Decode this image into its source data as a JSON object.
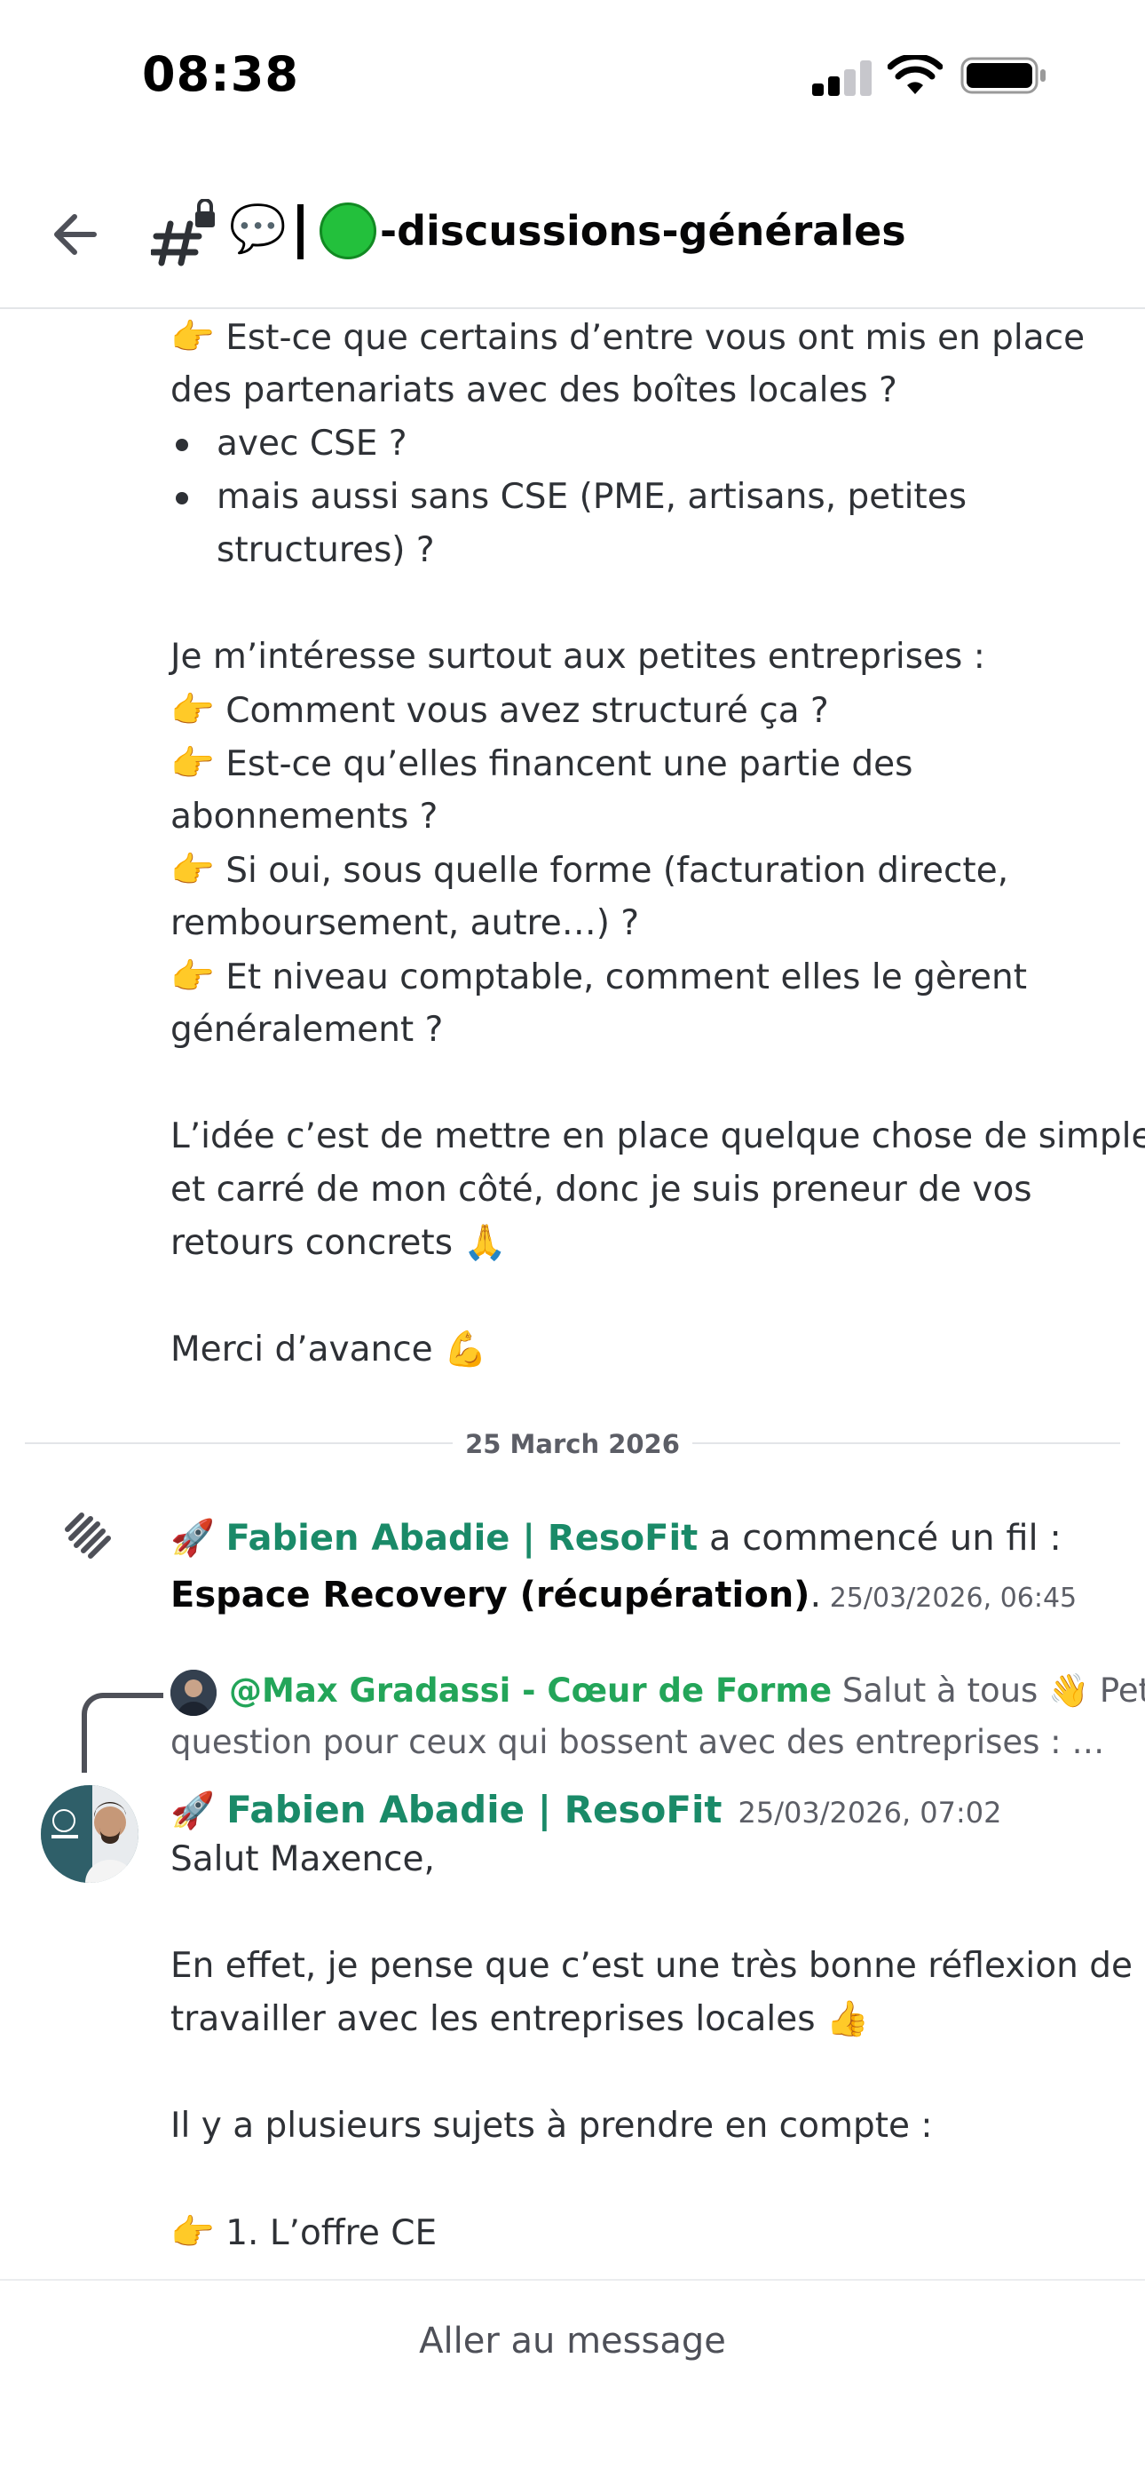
{
  "status": {
    "time": "08:38"
  },
  "header": {
    "speech_emoji": "💬",
    "channel_title": "-discussions-générales"
  },
  "prev_message": {
    "lines": [
      {
        "type": "text",
        "emoji": "👉",
        "text": " Est-ce que certains d’entre vous ont mis en place"
      },
      {
        "type": "text",
        "emoji": "",
        "text": "des partenariats avec des boîtes locales ?"
      },
      {
        "type": "bullet",
        "text": "avec CSE ?"
      },
      {
        "type": "bullet",
        "text": "mais aussi sans CSE (PME, artisans, petites"
      },
      {
        "type": "indent",
        "text": "structures) ?"
      },
      {
        "type": "blank"
      },
      {
        "type": "text",
        "emoji": "",
        "text": "Je m’intéresse surtout aux petites entreprises :"
      },
      {
        "type": "text",
        "emoji": "👉",
        "text": " Comment vous avez structuré ça ?"
      },
      {
        "type": "text",
        "emoji": "👉",
        "text": " Est-ce qu’elles financent une partie des"
      },
      {
        "type": "text",
        "emoji": "",
        "text": "abonnements ?"
      },
      {
        "type": "text",
        "emoji": "👉",
        "text": " Si oui, sous quelle forme (facturation directe,"
      },
      {
        "type": "text",
        "emoji": "",
        "text": "remboursement, autre…) ?"
      },
      {
        "type": "text",
        "emoji": "👉",
        "text": " Et niveau comptable, comment elles le gèrent"
      },
      {
        "type": "text",
        "emoji": "",
        "text": "généralement ?"
      },
      {
        "type": "blank"
      },
      {
        "type": "text",
        "emoji": "",
        "text": "L’idée c’est de mettre en place quelque chose de simple"
      },
      {
        "type": "text",
        "emoji": "",
        "text": "et carré de mon côté, donc je suis preneur de vos"
      },
      {
        "type": "text",
        "emoji": "",
        "text": "retours concrets 🙏"
      },
      {
        "type": "blank"
      },
      {
        "type": "text",
        "emoji": "",
        "text": "Merci d’avance 💪"
      }
    ]
  },
  "date_divider": "25 March 2026",
  "thread_notice": {
    "rocket": "🚀",
    "author": "Fabien Abadie | ResoFit",
    "action": " a commencé un fil :",
    "thread_name": "Espace Recovery (récupération)",
    "period": ".",
    "timestamp": " 25/03/2026, 06:45"
  },
  "reply_preview": {
    "mention": "@Max Gradassi - Cœur de Forme",
    "text_line1": " Salut à tous 👋 Petite",
    "text_line2": "question pour ceux qui bossent avec des entreprises : 👉…"
  },
  "main_message": {
    "rocket": "🚀",
    "author": "Fabien Abadie | ResoFit",
    "timestamp": "25/03/2026, 07:02",
    "lines": [
      {
        "type": "text",
        "emoji": "",
        "text": "Salut Maxence,"
      },
      {
        "type": "blank"
      },
      {
        "type": "text",
        "emoji": "",
        "text": "En effet, je pense que c’est une très bonne réflexion de"
      },
      {
        "type": "text",
        "emoji": "",
        "text": "travailler avec les entreprises locales 👍"
      },
      {
        "type": "blank"
      },
      {
        "type": "text",
        "emoji": "",
        "text": "Il y a plusieurs sujets à prendre en compte :"
      },
      {
        "type": "blank"
      },
      {
        "type": "text",
        "emoji": "👉",
        "text": " 1. L’offre CE"
      }
    ]
  },
  "bottom": {
    "jump_label": "Aller au message"
  },
  "colors": {
    "author_green": "#1a8a68",
    "mention_green": "#23a559",
    "status_dot": "#23c03c"
  }
}
